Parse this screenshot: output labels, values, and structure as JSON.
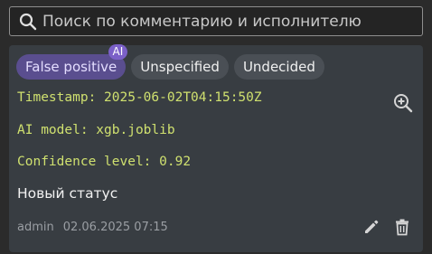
{
  "search": {
    "placeholder": "Поиск по комментарию и исполнителю",
    "value": "",
    "icon": "search-icon"
  },
  "chips": [
    {
      "label": "False positive",
      "selected": true,
      "badge": "AI"
    },
    {
      "label": "Unspecified",
      "selected": false
    },
    {
      "label": "Undecided",
      "selected": false
    }
  ],
  "details": {
    "timestamp": "Timestamp: 2025-06-02T04:15:50Z",
    "ai_model": "AI model: xgb.joblib",
    "confidence": "Confidence level: 0.92"
  },
  "status_text": "Новый статус",
  "footer": {
    "user": "admin",
    "datetime": "02.06.2025 07:15"
  },
  "icons": {
    "zoom": "zoom-in-icon",
    "edit": "pencil-icon",
    "delete": "trash-icon"
  },
  "colors": {
    "background": "#2b2b2b",
    "card": "#383d42",
    "chip": "#4a4f55",
    "chip_selected": "#5a4e8f",
    "ai_badge": "#7b60c8",
    "detail_text": "#cfe06f",
    "footer_text": "#9a9ea3"
  }
}
